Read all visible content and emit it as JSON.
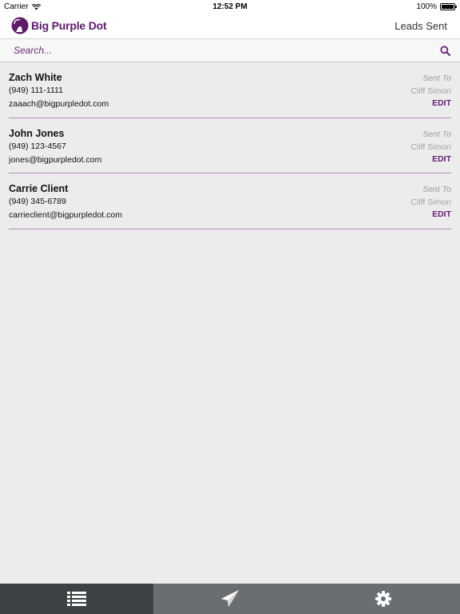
{
  "status": {
    "carrier": "Carrier",
    "time": "12:52 PM",
    "battery": "100%"
  },
  "header": {
    "brand": "Big Purple Dot",
    "title": "Leads Sent"
  },
  "search": {
    "placeholder": "Search...",
    "value": ""
  },
  "leads": [
    {
      "name": "Zach White",
      "phone": "(949) 111-1111",
      "email": "zaaach@bigpurpledot.com",
      "sent_to_label": "Sent To",
      "sent_to": "Cliff Simon",
      "edit_label": "EDIT"
    },
    {
      "name": "John Jones",
      "phone": "(949) 123-4567",
      "email": "jones@bigpurpledot.com",
      "sent_to_label": "Sent To",
      "sent_to": "Cliff Simon",
      "edit_label": "EDIT"
    },
    {
      "name": "Carrie Client",
      "phone": "(949) 345-6789",
      "email": "carrieclient@bigpurpledot.com",
      "sent_to_label": "Sent To",
      "sent_to": "Cliff Simon",
      "edit_label": "EDIT"
    }
  ],
  "tabs": [
    {
      "icon": "list-icon",
      "active": true
    },
    {
      "icon": "send-icon",
      "active": false
    },
    {
      "icon": "gear-icon",
      "active": false
    }
  ],
  "colors": {
    "brand": "#5f1a6a",
    "accent": "#6b1f79",
    "tab_active": "#3c4144",
    "tab_inactive": "#6b6e71",
    "divider": "#b58cbd"
  }
}
